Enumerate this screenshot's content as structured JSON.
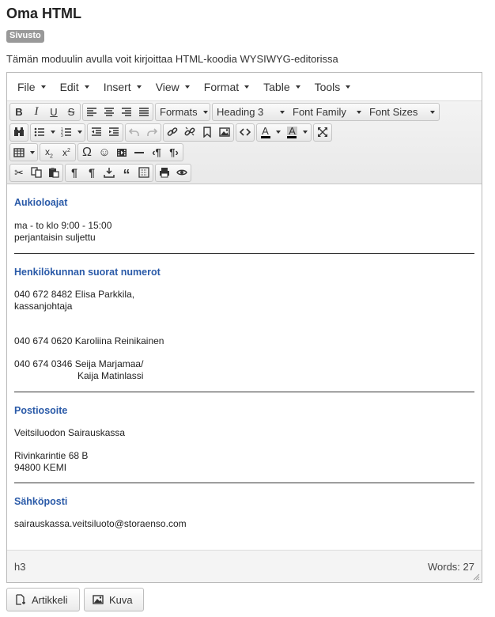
{
  "page": {
    "title": "Oma HTML",
    "badge": "Sivusto",
    "description": "Tämän moduulin avulla voit kirjoittaa HTML-koodia WYSIWYG-editorissa"
  },
  "menubar": {
    "items": [
      "File",
      "Edit",
      "Insert",
      "View",
      "Format",
      "Table",
      "Tools"
    ]
  },
  "toolbar": {
    "formats_label": "Formats",
    "heading_value": "Heading 3",
    "font_family_label": "Font Family",
    "font_size_label": "Font Sizes"
  },
  "content": {
    "section1_heading": "Aukioloajat",
    "section1_line1": "ma - to klo 9:00 - 15:00",
    "section1_line2": "perjantaisin suljettu",
    "section2_heading": "Henkilökunnan suorat numerot",
    "section2_line1": "040 672 8482 Elisa Parkkila,",
    "section2_line2": "kassanjohtaja",
    "section2_line3": "040 674 0620 Karoliina Reinikainen",
    "section2_line4": "040 674 0346 Seija Marjamaa/",
    "section2_line5": "Kaija Matinlassi",
    "section3_heading": "Postiosoite",
    "section3_line1": "Veitsiluodon Sairauskassa",
    "section3_line2": "Rivinkarintie 68 B",
    "section3_line3": "94800 KEMI",
    "section4_heading": "Sähköposti",
    "section4_line1": "sairauskassa.veitsiluoto@storaenso.com"
  },
  "statusbar": {
    "path": "h3",
    "word_count": "Words: 27"
  },
  "buttons": {
    "article_label": "Artikkeli",
    "image_label": "Kuva"
  },
  "colors": {
    "heading_blue": "#2a5aa8",
    "badge_gray": "#999999"
  }
}
